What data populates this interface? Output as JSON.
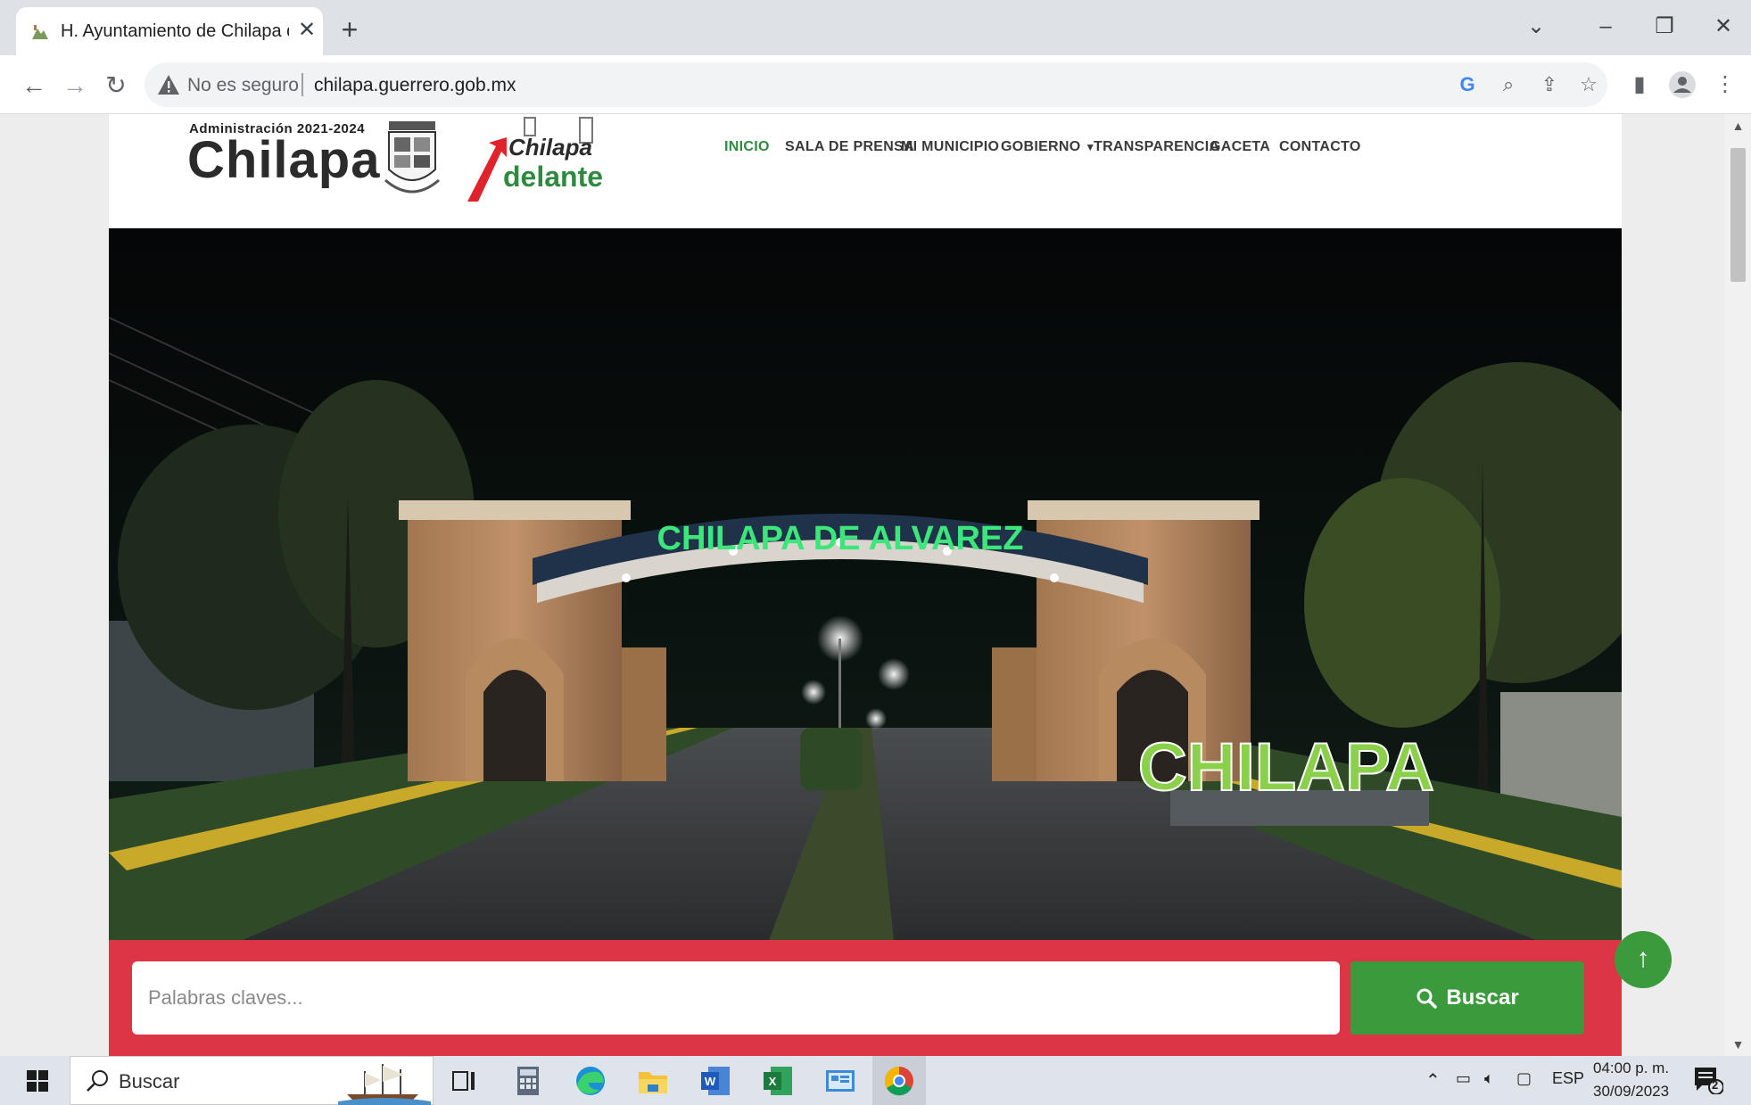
{
  "browser": {
    "tab_title": "H. Ayuntamiento de Chilapa de",
    "tab_close": "✕",
    "new_tab": "+",
    "security_label": "No es seguro",
    "url": "chilapa.guerrero.gob.mx"
  },
  "site": {
    "admin_label": "Administración 2021-2024",
    "brand": "Chilapa",
    "campaign_top": "Chilapa",
    "campaign_bottom": "delante",
    "nav": [
      {
        "label": "INICIO",
        "active": true
      },
      {
        "label": "SALA DE PRENSA"
      },
      {
        "label": "MI MUNICIPIO"
      },
      {
        "label": "GOBIERNO"
      },
      {
        "label": "TRANSPARENCIA"
      },
      {
        "label": "GACETA"
      },
      {
        "label": "CONTACTO"
      }
    ],
    "hero": {
      "arch_sign": "CHILAPA DE ALVAREZ",
      "letters_sign": "CHILAPA"
    },
    "search": {
      "placeholder": "Palabras claves...",
      "button": "Buscar"
    }
  },
  "taskbar": {
    "search_label": "Buscar",
    "language": "ESP",
    "time": "04:00 p. m.",
    "date": "30/09/2023",
    "notifications": "2"
  },
  "colors": {
    "accent_green": "#3a9a3c",
    "band_red": "#dc3545",
    "nav_active": "#2e8b3e"
  }
}
